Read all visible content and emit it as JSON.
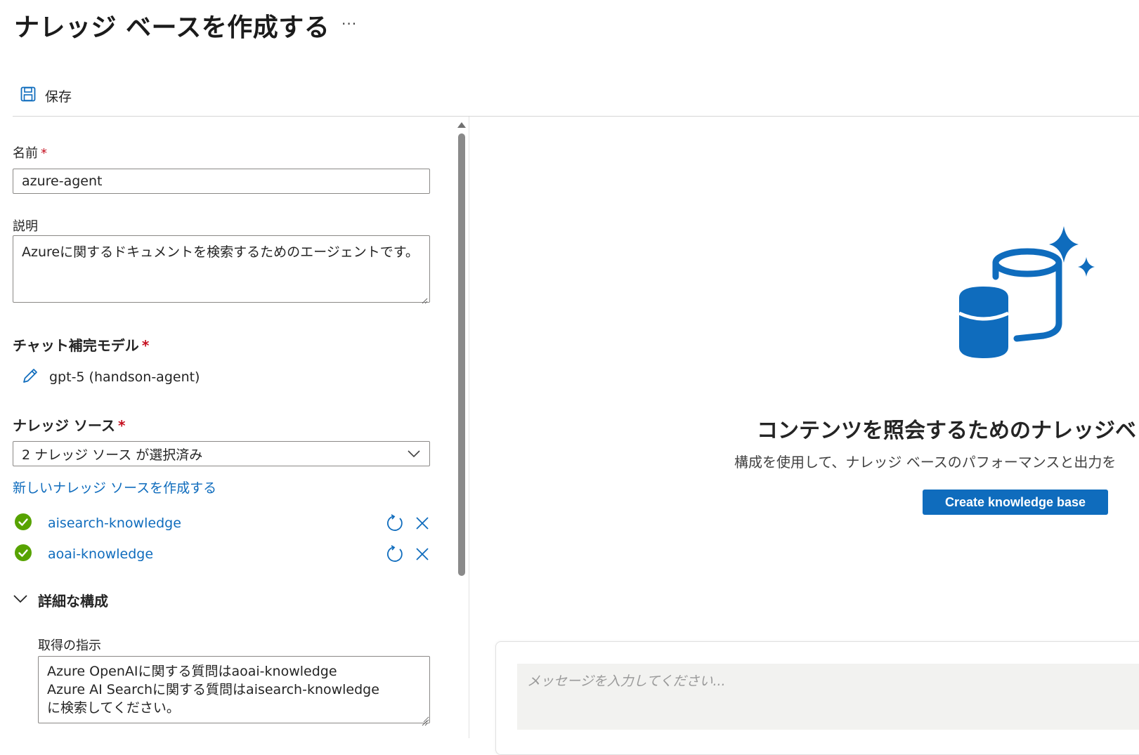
{
  "header": {
    "title": "ナレッジ ベースを作成する",
    "more": "···"
  },
  "toolbar": {
    "save_label": "保存"
  },
  "form": {
    "name": {
      "label": "名前",
      "required_mark": "*",
      "value": "azure-agent"
    },
    "description": {
      "label": "説明",
      "value": "Azureに関するドキュメントを検索するためのエージェントです。"
    },
    "chat_model": {
      "label": "チャット補完モデル",
      "required_mark": "*",
      "value": "gpt-5 (handson-agent)"
    },
    "knowledge_sources": {
      "label": "ナレッジ ソース",
      "required_mark": "*",
      "selected_text": "2 ナレッジ ソース が選択済み",
      "create_link": "新しいナレッジ ソースを作成する",
      "items": [
        {
          "name": "aisearch-knowledge",
          "status": "success"
        },
        {
          "name": "aoai-knowledge",
          "status": "success"
        }
      ]
    },
    "advanced": {
      "label": "詳細な構成",
      "retrieval_instructions": {
        "label": "取得の指示",
        "value": "Azure OpenAIに関する質問はaoai-knowledge\nAzure AI Searchに関する質問はaisearch-knowledge\nに検索してください。"
      }
    }
  },
  "empty_state": {
    "title": "コンテンツを照会するためのナレッジベ",
    "description": "構成を使用して、ナレッジ ベースのパフォーマンスと出力を",
    "button_label": "Create knowledge base"
  },
  "chat": {
    "placeholder": "メッセージを入力してください..."
  },
  "colors": {
    "accent": "#0f6cbd",
    "success": "#57a300",
    "required": "#c50f1f"
  },
  "icons": [
    "save-icon",
    "more-icon",
    "pencil-icon",
    "chevron-down-icon",
    "check-circle-icon",
    "refresh-icon",
    "close-icon",
    "database-sparkle-icon"
  ]
}
